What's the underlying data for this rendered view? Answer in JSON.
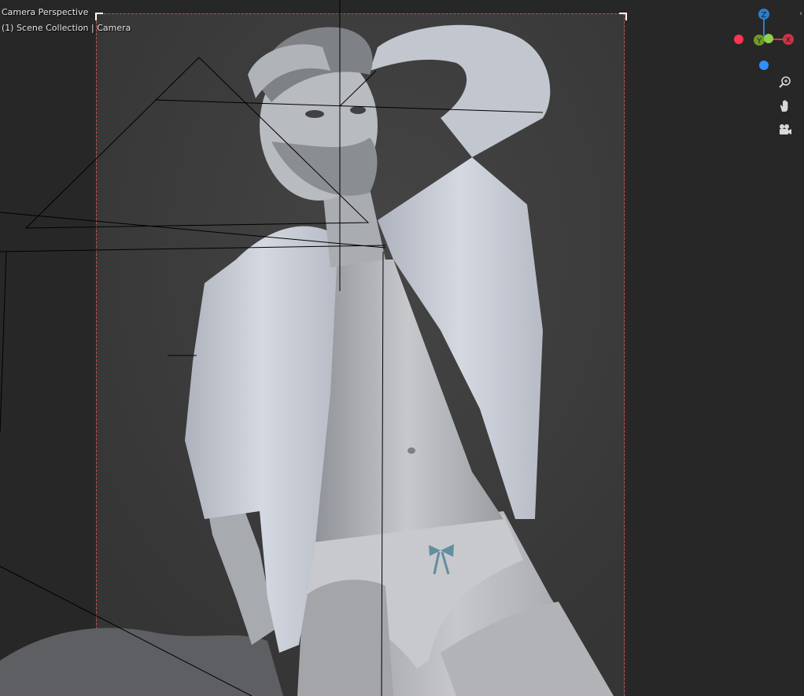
{
  "viewport": {
    "view_name": "Camera Perspective",
    "scene_info": "(1) Scene Collection | Camera"
  },
  "gizmo": {
    "axes": [
      {
        "name": "Z",
        "label": "Z",
        "color": "#2f7fc6"
      },
      {
        "name": "Y",
        "label": "Y",
        "color": "#7aa32b"
      },
      {
        "name": "X",
        "label": "X",
        "color": "#d0384a"
      }
    ],
    "neg_axes": [
      {
        "name": "-X",
        "color": "#ff3352"
      },
      {
        "name": "-Z",
        "color": "#2f8fff"
      }
    ]
  },
  "nav_tools": [
    {
      "name": "zoom",
      "icon": "zoom-magnifier-icon"
    },
    {
      "name": "pan",
      "icon": "hand-pan-icon"
    },
    {
      "name": "camera-view",
      "icon": "movie-camera-icon"
    }
  ],
  "colors": {
    "background": "#2e2e2e",
    "camera_bg": "#3b3b3b",
    "frame_border": "#c0504d",
    "model": "#bfc3ca",
    "shirt": "#c9cdd6",
    "bow": "#5f8fa0"
  }
}
